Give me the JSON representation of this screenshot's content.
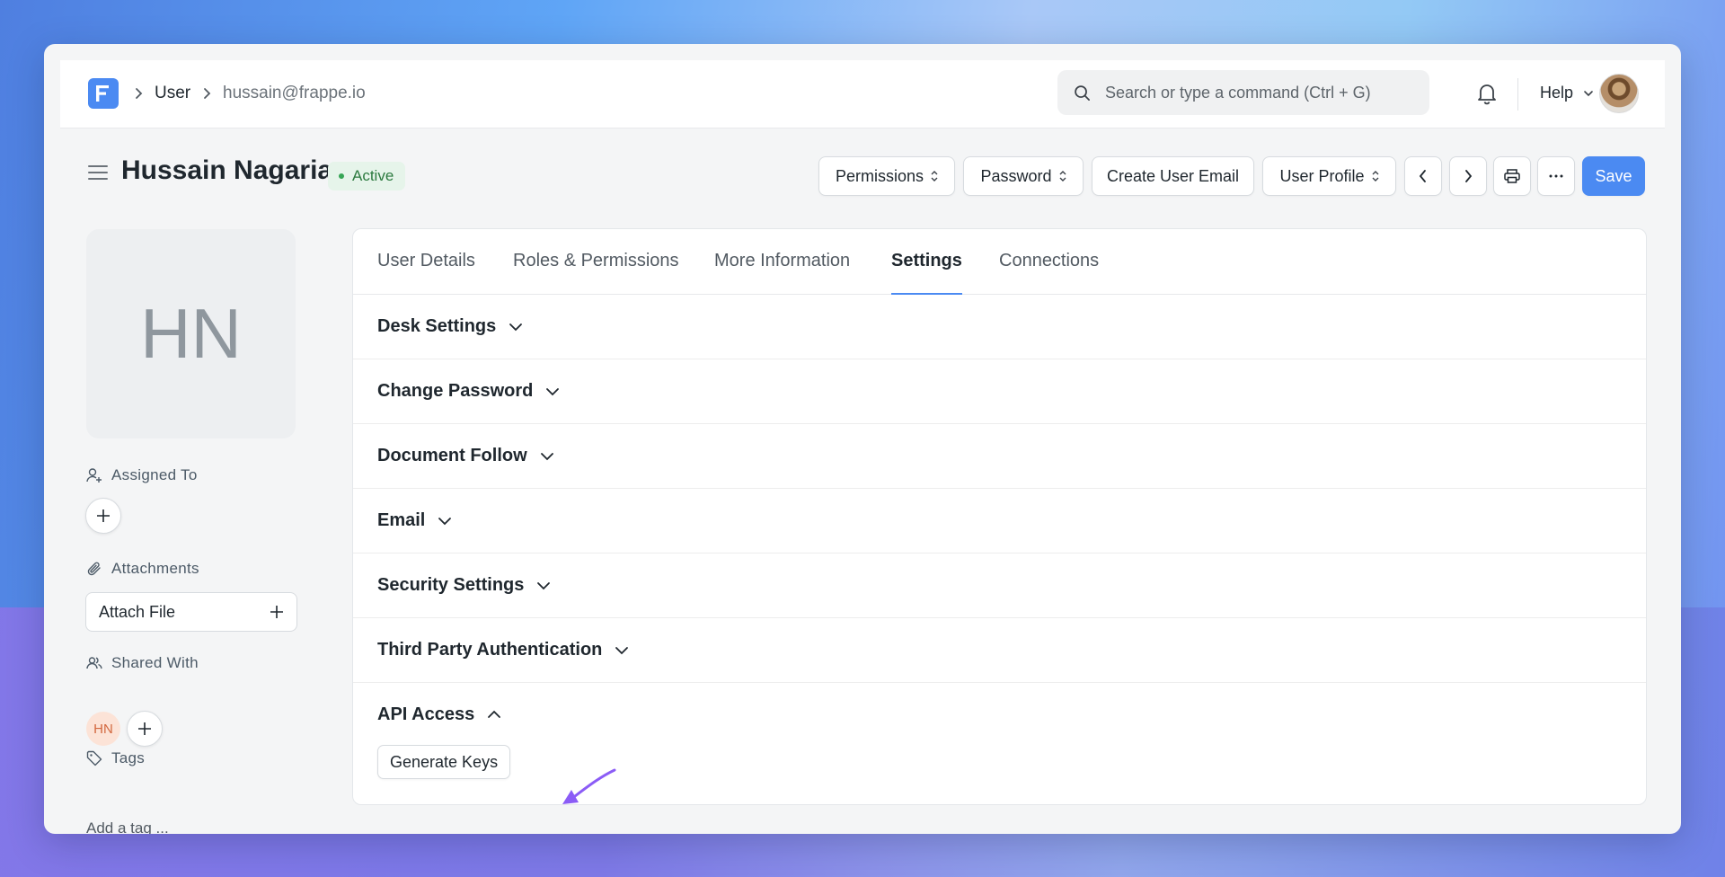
{
  "breadcrumb": {
    "items": [
      "User",
      "hussain@frappe.io"
    ]
  },
  "search": {
    "placeholder": "Search or type a command (Ctrl + G)"
  },
  "navbar": {
    "help_label": "Help"
  },
  "header": {
    "title": "Hussain Nagaria",
    "status": "Active",
    "buttons": {
      "permissions": "Permissions",
      "password": "Password",
      "create_user_email": "Create User Email",
      "user_profile": "User Profile",
      "save": "Save"
    }
  },
  "sidebar": {
    "avatar_initials": "HN",
    "assigned_to": "Assigned To",
    "attachments": "Attachments",
    "attach_file": "Attach File",
    "shared_with": "Shared With",
    "shared_initials": "HN",
    "tags": "Tags",
    "add_tag": "Add a tag ..."
  },
  "tabs": [
    "User Details",
    "Roles & Permissions",
    "More Information",
    "Settings",
    "Connections"
  ],
  "sections": [
    "Desk Settings",
    "Change Password",
    "Document Follow",
    "Email",
    "Security Settings",
    "Third Party Authentication",
    "API Access"
  ],
  "api_access": {
    "generate_keys": "Generate Keys"
  },
  "colors": {
    "primary": "#4b8af2",
    "active_badge_bg": "#e6f4ea",
    "active_badge_text": "#2c7a3f",
    "arrow": "#8b5cf6"
  }
}
